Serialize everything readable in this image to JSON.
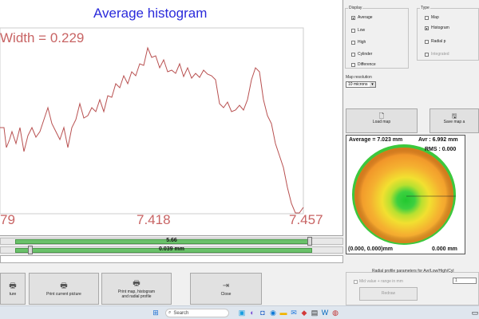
{
  "histogram": {
    "title": "Average histogram",
    "width_label": "Width = 0.229",
    "x_ticks": [
      "79",
      "7.418",
      "7.457"
    ],
    "curve_color": "#b85050",
    "title_color": "#2a2adb"
  },
  "sliders": {
    "top_value": "5.66",
    "top_fraction": 0.96,
    "bottom_value": "0.039 mm",
    "bottom_fraction": 0.05
  },
  "bottom_buttons": [
    {
      "label": "ture",
      "icon": "printer-icon"
    },
    {
      "label": "Print current picture",
      "icon": "printer-icon"
    },
    {
      "label": "Print map, histogram and radial profile",
      "icon": "printer-icon"
    },
    {
      "label": "Close",
      "icon": "exit-icon"
    }
  ],
  "display": {
    "title": "Display",
    "options": [
      "Average",
      "Low",
      "High",
      "Cylinder",
      "Difference"
    ],
    "selected": "Average"
  },
  "type": {
    "title": "Type",
    "options": [
      "Map",
      "Histogram",
      "Radial p",
      "Integrated"
    ],
    "selected": "Histogram",
    "disabled": [
      "Integrated"
    ]
  },
  "map_resolution": {
    "label": "Map resolution",
    "value": "10 microns"
  },
  "panel_buttons": {
    "load_map": "Load map",
    "save_map": "Save map a"
  },
  "map": {
    "average": "Average = 7.023 mm",
    "avr": "Avr : 6.992 mm",
    "rms": "RMS : 0.000",
    "origin": "(0.000, 0.000)mm",
    "value": "0.000 mm"
  },
  "radial": {
    "title": "Radial profile parameters for Avr/Low/High/Cyl",
    "checkbox_label": "Mid value + range in mm",
    "input_value": "1",
    "button_label": "Redraw"
  },
  "taskbar": {
    "search_placeholder": "Search"
  }
}
